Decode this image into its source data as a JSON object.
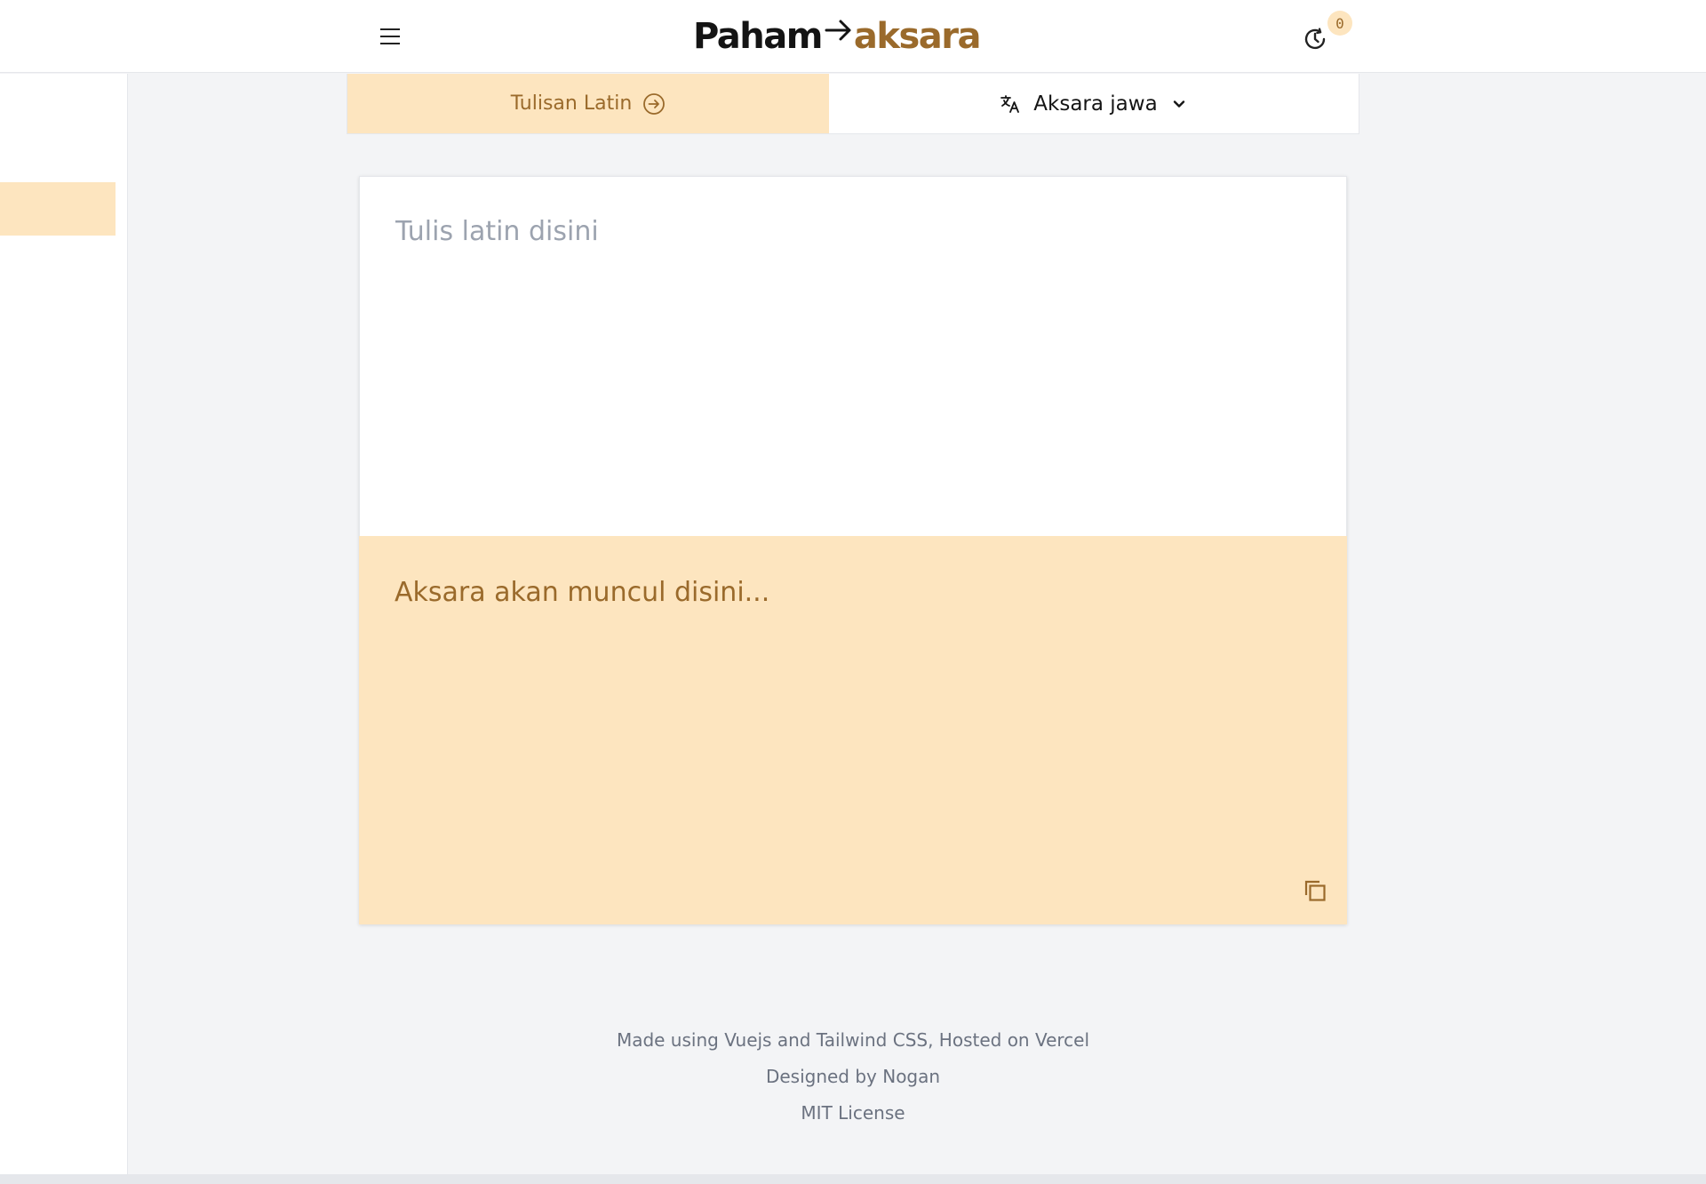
{
  "header": {
    "logo": {
      "part1": "Paham",
      "part2": "aksara"
    },
    "menu_icon": "hamburger-menu-icon",
    "history_icon": "history-clock-icon",
    "history_count": "0"
  },
  "language_bar": {
    "source_label": "Tulisan Latin",
    "source_icon": "arrow-right-circle-icon",
    "target_label": "Aksara jawa",
    "target_icon": "translate-icon",
    "dropdown_icon": "chevron-down-icon"
  },
  "translator": {
    "input_placeholder": "Tulis latin disini",
    "input_value": "",
    "output_placeholder": "Aksara akan muncul disini...",
    "copy_icon": "copy-icon"
  },
  "footer": {
    "line1": "Made using Vuejs and Tailwind CSS, Hosted on Vercel",
    "line2": "Designed by Nogan",
    "line3": "MIT License"
  },
  "colors": {
    "accent_bg": "#fde5bf",
    "accent_text": "#9a6a2b",
    "page_bg": "#f3f4f6"
  }
}
